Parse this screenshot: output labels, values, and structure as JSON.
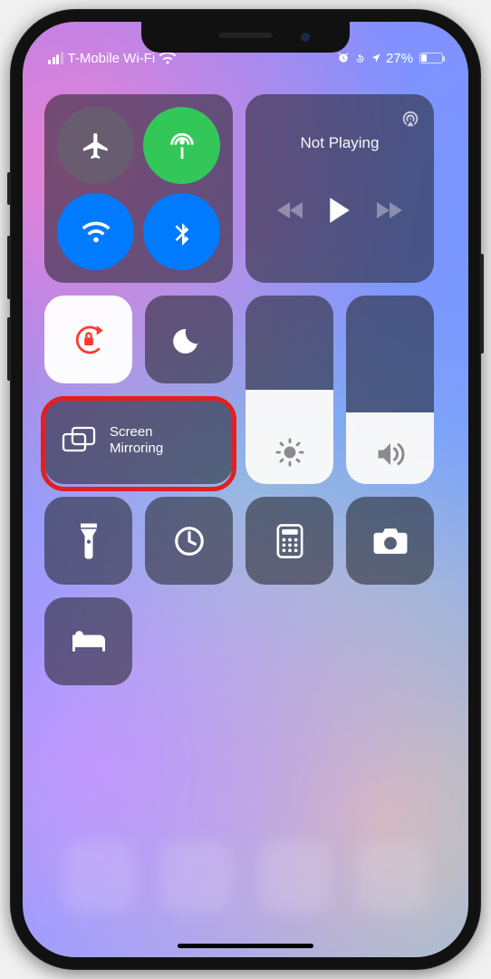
{
  "status": {
    "carrier": "T-Mobile Wi-Fi",
    "battery_pct": "27%"
  },
  "connectivity": {
    "airplane": {
      "name": "airplane-mode",
      "on": false
    },
    "cellular": {
      "name": "cellular-data",
      "on": true,
      "color": "#33c759"
    },
    "wifi": {
      "name": "wifi",
      "on": true,
      "color": "#007aff"
    },
    "bluetooth": {
      "name": "bluetooth",
      "on": true,
      "color": "#007aff"
    }
  },
  "media": {
    "now_playing": "Not Playing"
  },
  "toggles": {
    "orientation_lock": {
      "on": true
    },
    "do_not_disturb": {
      "on": false
    }
  },
  "screen_mirroring": {
    "label_line1": "Screen",
    "label_line2": "Mirroring"
  },
  "sliders": {
    "brightness_pct": 50,
    "volume_pct": 38
  },
  "shortcuts": [
    "flashlight",
    "timer",
    "calculator",
    "camera",
    "sleep"
  ],
  "annotation": {
    "highlight_target": "screen-mirroring-tile",
    "color": "#e2201f"
  }
}
